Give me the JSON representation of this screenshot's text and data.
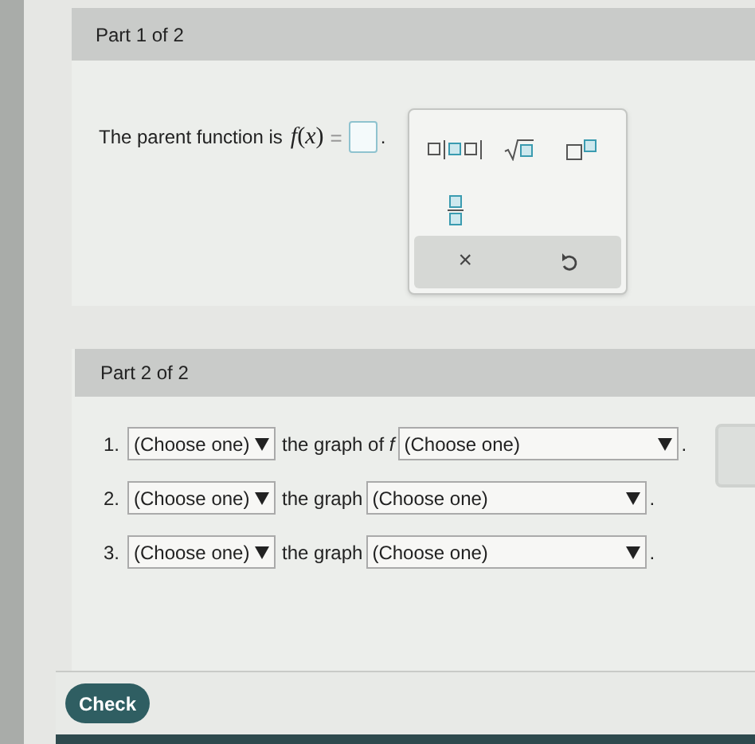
{
  "part1": {
    "header": "Part 1 of 2",
    "prompt": "The parent function is",
    "math": "*f*(*x*)",
    "equals": "=",
    "end": ".",
    "keypad": {
      "keys": [
        {
          "kind": "mixed"
        },
        {
          "kind": "sqrt"
        },
        {
          "kind": "power"
        },
        {
          "kind": "fraction"
        }
      ],
      "clear": "×"
    }
  },
  "part2": {
    "header": "Part 2 of 2",
    "rows": [
      {
        "number": "1.",
        "first": "(Choose one)",
        "middle": "the graph of *f*",
        "second": "(Choose one)",
        "end": "."
      },
      {
        "number": "2.",
        "first": "(Choose one)",
        "middle": "the graph",
        "second": "(Choose one)",
        "end": "."
      },
      {
        "number": "3.",
        "first": "(Choose one)",
        "middle": "the graph",
        "second": "(Choose one)",
        "end": "."
      }
    ]
  },
  "check_button": "Check"
}
